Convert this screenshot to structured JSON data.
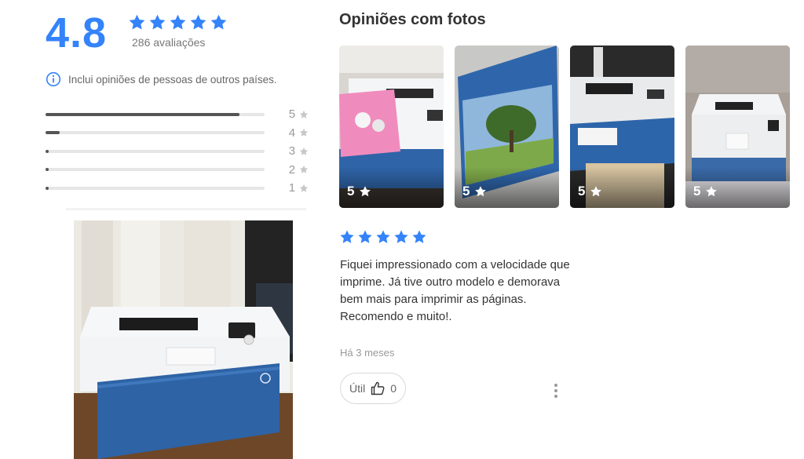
{
  "summary": {
    "score": "4.8",
    "rating_count": "286 avaliações",
    "info_text": "Inclui opiniões de pessoas de outros países.",
    "icons": {
      "info": "info-circle-icon",
      "star": "star-icon"
    },
    "accent_color": "#3483fa",
    "distribution": [
      {
        "stars": "5",
        "fraction": 0.885
      },
      {
        "stars": "4",
        "fraction": 0.065
      },
      {
        "stars": "3",
        "fraction": 0.012
      },
      {
        "stars": "2",
        "fraction": 0.008
      },
      {
        "stars": "1",
        "fraction": 0.012
      }
    ]
  },
  "photos_section": {
    "title": "Opiniões com fotos",
    "thumbnails": [
      {
        "rating": "5",
        "image": "printer-with-flyer"
      },
      {
        "rating": "5",
        "image": "tree-landscape-print"
      },
      {
        "rating": "5",
        "image": "printer-on-cabinet"
      },
      {
        "rating": "5",
        "image": "printer-on-lace"
      }
    ]
  },
  "review": {
    "rating": 5,
    "text": "Fiquei impressionado com a velocidade que imprime. Já tive outro modelo e demorava bem mais para imprimir as páginas. Recomendo e muito!.",
    "date": "Há 3 meses",
    "useful_label": "Útil",
    "useful_count": "0",
    "icons": {
      "useful": "thumbs-up-icon",
      "more": "more-vertical-icon"
    }
  }
}
